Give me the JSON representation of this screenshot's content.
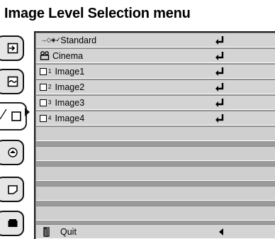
{
  "title": "Image Level Selection menu",
  "menu": {
    "items": [
      {
        "icon": "standard-icon",
        "label": "Standard",
        "prefix": "→◇◈✓",
        "action": "enter"
      },
      {
        "icon": "cinema-icon",
        "label": "Cinema",
        "action": "enter"
      },
      {
        "icon": "image-box-icon",
        "num": "1",
        "label": "Image1",
        "action": "enter"
      },
      {
        "icon": "image-box-icon",
        "num": "2",
        "label": "Image2",
        "action": "enter"
      },
      {
        "icon": "image-box-icon",
        "num": "3",
        "label": "Image3",
        "action": "enter"
      },
      {
        "icon": "image-box-icon",
        "num": "4",
        "label": "Image4",
        "action": "enter"
      }
    ],
    "quit_label": "Quit"
  },
  "tabs": [
    "input-icon",
    "picture-adjust-icon",
    "image-select-icon",
    "screen-icon",
    "setting-icon",
    "projector-icon"
  ]
}
